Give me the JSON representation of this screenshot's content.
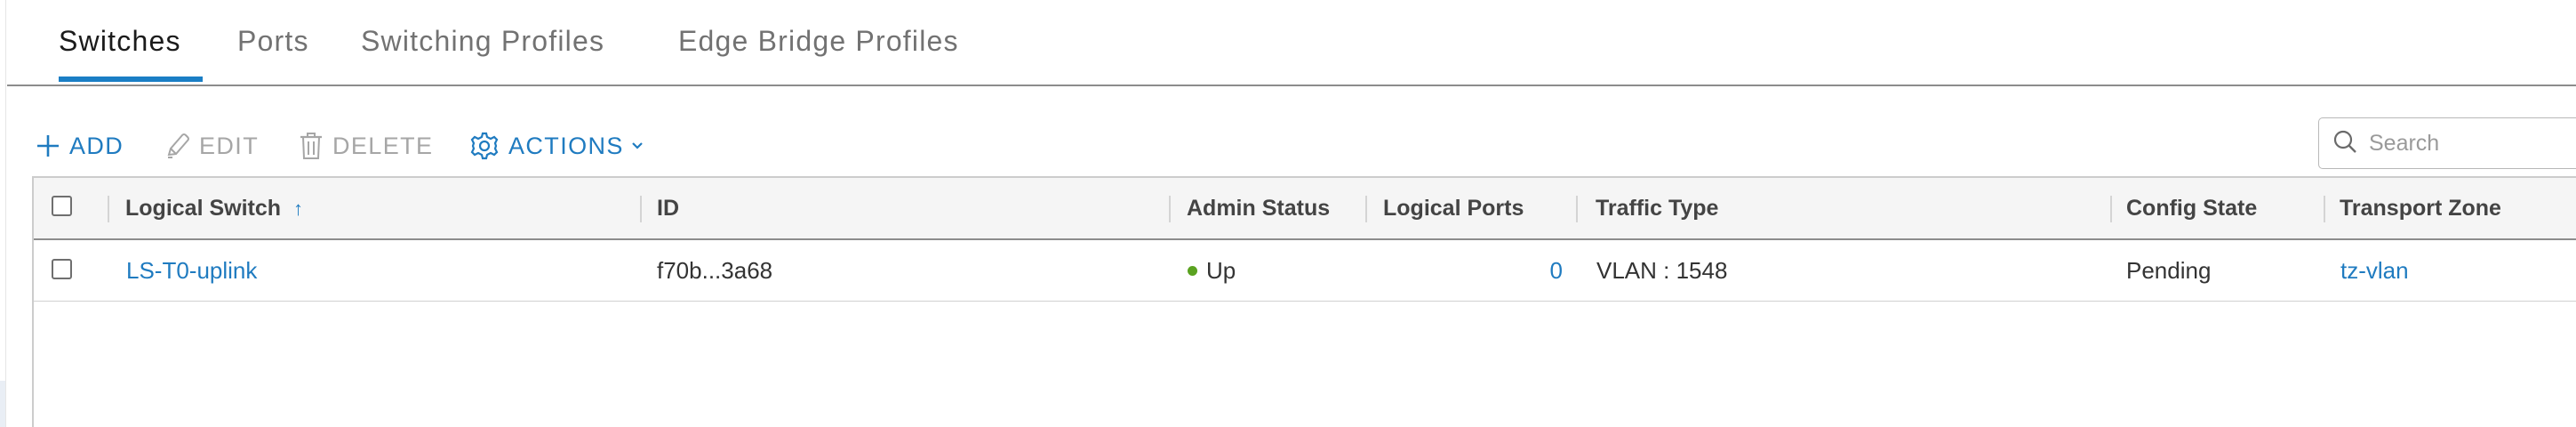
{
  "tabs": [
    {
      "label": "Switches"
    },
    {
      "label": "Ports"
    },
    {
      "label": "Switching Profiles"
    },
    {
      "label": "Edge Bridge Profiles"
    }
  ],
  "active_tab": "Switches",
  "toolbar": {
    "add_label": "ADD",
    "edit_label": "EDIT",
    "delete_label": "DELETE",
    "actions_label": "ACTIONS",
    "search_placeholder": "Search"
  },
  "colors": {
    "accent": "#1f7bc0",
    "status_up": "#5aa220",
    "disabled": "#a6a6a6"
  },
  "table": {
    "columns": [
      {
        "label": "Logical Switch",
        "sorted": "ascending"
      },
      {
        "label": "ID"
      },
      {
        "label": "Admin Status"
      },
      {
        "label": "Logical Ports"
      },
      {
        "label": "Traffic Type"
      },
      {
        "label": "Config State"
      },
      {
        "label": "Transport Zone"
      }
    ],
    "rows": [
      {
        "logical_switch": "LS-T0-uplink",
        "id": "f70b...3a68",
        "admin_status": "Up",
        "logical_ports": "0",
        "traffic_type": "VLAN : 1548",
        "config_state": "Pending",
        "transport_zone": "tz-vlan"
      }
    ]
  }
}
